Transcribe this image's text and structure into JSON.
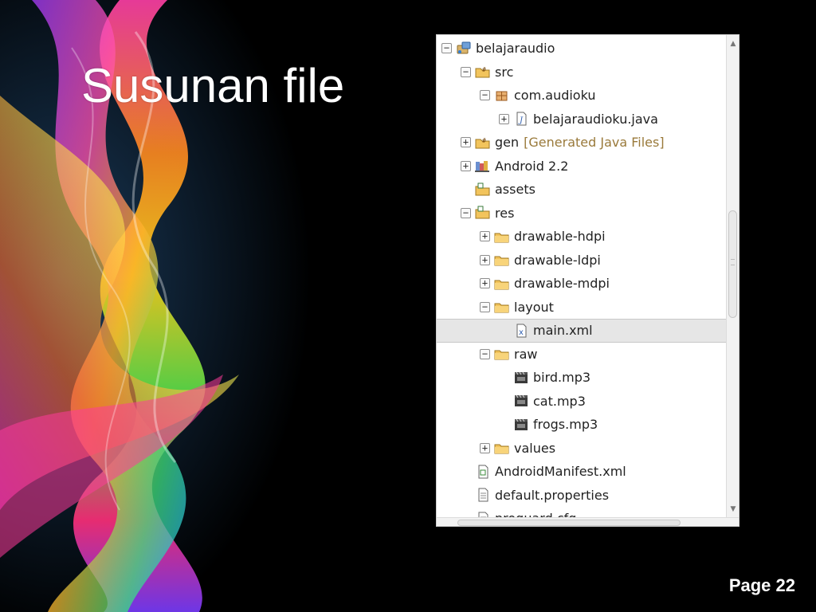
{
  "slide": {
    "title": "Susunan file",
    "page_label": "Page 22"
  },
  "explorer": {
    "items": [
      {
        "label": "belajaraudio",
        "depth": 0,
        "toggle": "−",
        "icon": "android-project-icon"
      },
      {
        "label": "src",
        "depth": 1,
        "toggle": "−",
        "icon": "source-folder-icon"
      },
      {
        "label": "com.audioku",
        "depth": 2,
        "toggle": "−",
        "icon": "package-icon"
      },
      {
        "label": "belajaraudioku.java",
        "depth": 3,
        "toggle": "+",
        "icon": "java-file-icon"
      },
      {
        "label": "gen",
        "decoration": "[Generated Java Files]",
        "depth": 1,
        "toggle": "+",
        "icon": "source-folder-icon"
      },
      {
        "label": "Android 2.2",
        "depth": 1,
        "toggle": "+",
        "icon": "library-icon"
      },
      {
        "label": "assets",
        "depth": 1,
        "toggle": "",
        "icon": "project-folder-icon"
      },
      {
        "label": "res",
        "depth": 1,
        "toggle": "−",
        "icon": "project-folder-icon"
      },
      {
        "label": "drawable-hdpi",
        "depth": 2,
        "toggle": "+",
        "icon": "folder-icon"
      },
      {
        "label": "drawable-ldpi",
        "depth": 2,
        "toggle": "+",
        "icon": "folder-icon"
      },
      {
        "label": "drawable-mdpi",
        "depth": 2,
        "toggle": "+",
        "icon": "folder-icon"
      },
      {
        "label": "layout",
        "depth": 2,
        "toggle": "−",
        "icon": "folder-icon"
      },
      {
        "label": "main.xml",
        "depth": 3,
        "toggle": "",
        "icon": "xml-file-icon",
        "selected": true
      },
      {
        "label": "raw",
        "depth": 2,
        "toggle": "−",
        "icon": "folder-icon"
      },
      {
        "label": "bird.mp3",
        "depth": 3,
        "toggle": "",
        "icon": "media-file-icon"
      },
      {
        "label": "cat.mp3",
        "depth": 3,
        "toggle": "",
        "icon": "media-file-icon"
      },
      {
        "label": "frogs.mp3",
        "depth": 3,
        "toggle": "",
        "icon": "media-file-icon"
      },
      {
        "label": "values",
        "depth": 2,
        "toggle": "+",
        "icon": "folder-icon"
      },
      {
        "label": "AndroidManifest.xml",
        "depth": 1,
        "toggle": "",
        "icon": "manifest-file-icon"
      },
      {
        "label": "default.properties",
        "depth": 1,
        "toggle": "",
        "icon": "text-file-icon"
      },
      {
        "label": "proguard.cfg",
        "depth": 1,
        "toggle": "",
        "icon": "text-file-icon"
      }
    ]
  },
  "colors": {
    "slide_background": "#000000",
    "title_text": "#ffffff",
    "decoration_text": "#9a7a3b",
    "selection": "#e6e6e6",
    "folder": "#f0c060"
  }
}
